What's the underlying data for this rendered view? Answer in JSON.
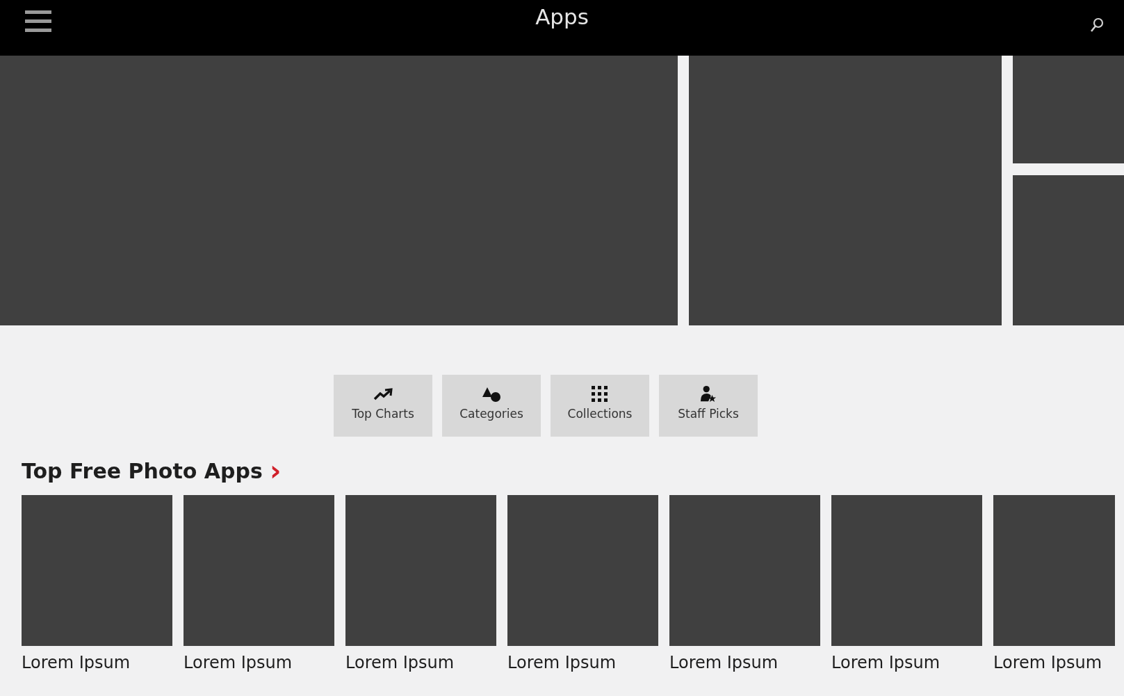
{
  "header": {
    "title": "Apps"
  },
  "nav_buttons": [
    {
      "label": "Top Charts",
      "kind": "charts"
    },
    {
      "label": "Categories",
      "kind": "shapes"
    },
    {
      "label": "Collections",
      "kind": "grid"
    },
    {
      "label": "Staff Picks",
      "kind": "person"
    }
  ],
  "section": {
    "title": "Top Free Photo Apps",
    "more": "›"
  },
  "apps": [
    {
      "name": "Lorem Ipsum"
    },
    {
      "name": "Lorem Ipsum"
    },
    {
      "name": "Lorem Ipsum"
    },
    {
      "name": "Lorem Ipsum"
    },
    {
      "name": "Lorem Ipsum"
    },
    {
      "name": "Lorem Ipsum"
    },
    {
      "name": "Lorem Ipsum"
    }
  ]
}
